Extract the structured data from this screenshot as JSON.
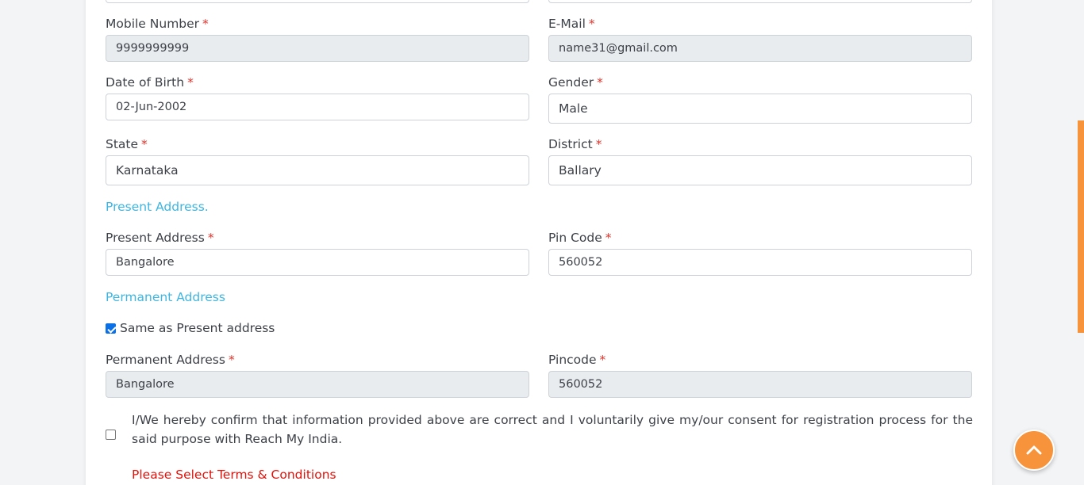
{
  "form": {
    "mobile": {
      "label": "Mobile Number",
      "required": "*",
      "value": "9999999999"
    },
    "email": {
      "label": "E-Mail",
      "required": "*",
      "value": "name31@gmail.com"
    },
    "dob": {
      "label": "Date of Birth",
      "required": "*",
      "value": "02-Jun-2002"
    },
    "gender": {
      "label": "Gender",
      "required": "*",
      "value": "Male"
    },
    "state": {
      "label": "State",
      "required": "*",
      "value": "Karnataka"
    },
    "district": {
      "label": "District",
      "required": "*",
      "value": "Ballary"
    },
    "present_section": "Present Address.",
    "present_address": {
      "label": "Present Address",
      "required": "*",
      "value": "Bangalore"
    },
    "pin_code": {
      "label": "Pin Code",
      "required": "*",
      "value": "560052"
    },
    "permanent_section": "Permanent Address",
    "same_as_present": {
      "label": "Same as Present address",
      "checked": true
    },
    "permanent_address": {
      "label": "Permanent Address",
      "required": "*",
      "value": "Bangalore"
    },
    "pincode": {
      "label": "Pincode",
      "required": "*",
      "value": "560052"
    },
    "consent": {
      "text": "I/We hereby confirm that information provided above are correct and I voluntarily give my/our consent for registration process for the said purpose with Reach My India.",
      "checked": false
    },
    "error": "Please Select Terms & Conditions"
  },
  "colors": {
    "accent_orange": "#f7933a",
    "section_blue": "#3db6e3",
    "required_red": "#e0342c",
    "error_red": "#e3120b"
  },
  "icons": {
    "scroll_top": "chevron-up-icon"
  }
}
